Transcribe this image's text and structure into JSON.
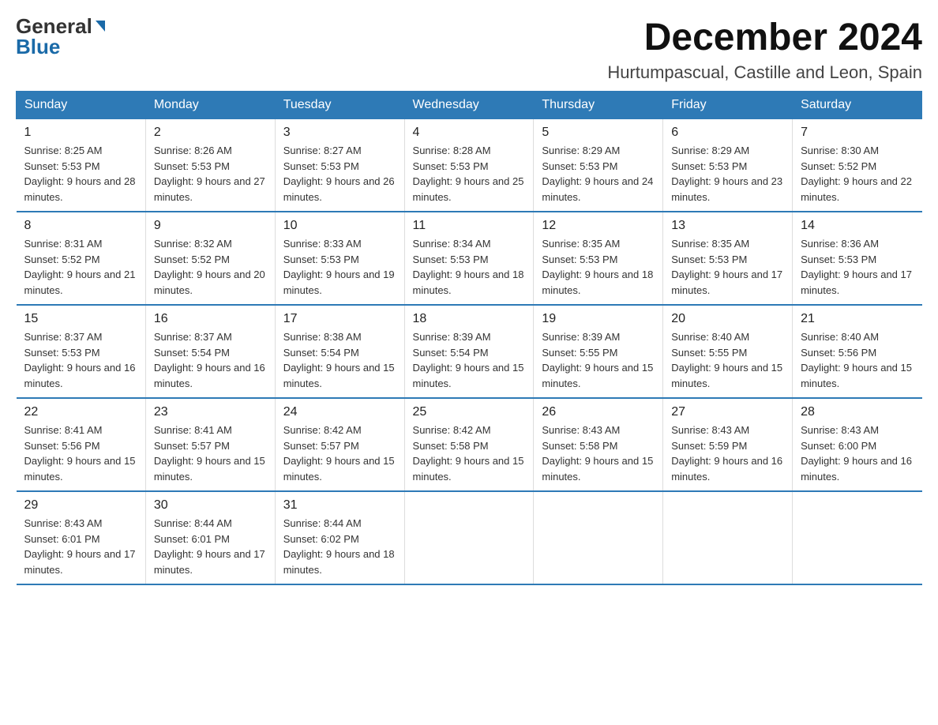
{
  "header": {
    "logo_general": "General",
    "logo_blue": "Blue",
    "month_title": "December 2024",
    "location": "Hurtumpascual, Castille and Leon, Spain"
  },
  "days_of_week": [
    "Sunday",
    "Monday",
    "Tuesday",
    "Wednesday",
    "Thursday",
    "Friday",
    "Saturday"
  ],
  "weeks": [
    [
      {
        "day": "1",
        "sunrise": "8:25 AM",
        "sunset": "5:53 PM",
        "daylight": "9 hours and 28 minutes."
      },
      {
        "day": "2",
        "sunrise": "8:26 AM",
        "sunset": "5:53 PM",
        "daylight": "9 hours and 27 minutes."
      },
      {
        "day": "3",
        "sunrise": "8:27 AM",
        "sunset": "5:53 PM",
        "daylight": "9 hours and 26 minutes."
      },
      {
        "day": "4",
        "sunrise": "8:28 AM",
        "sunset": "5:53 PM",
        "daylight": "9 hours and 25 minutes."
      },
      {
        "day": "5",
        "sunrise": "8:29 AM",
        "sunset": "5:53 PM",
        "daylight": "9 hours and 24 minutes."
      },
      {
        "day": "6",
        "sunrise": "8:29 AM",
        "sunset": "5:53 PM",
        "daylight": "9 hours and 23 minutes."
      },
      {
        "day": "7",
        "sunrise": "8:30 AM",
        "sunset": "5:52 PM",
        "daylight": "9 hours and 22 minutes."
      }
    ],
    [
      {
        "day": "8",
        "sunrise": "8:31 AM",
        "sunset": "5:52 PM",
        "daylight": "9 hours and 21 minutes."
      },
      {
        "day": "9",
        "sunrise": "8:32 AM",
        "sunset": "5:52 PM",
        "daylight": "9 hours and 20 minutes."
      },
      {
        "day": "10",
        "sunrise": "8:33 AM",
        "sunset": "5:53 PM",
        "daylight": "9 hours and 19 minutes."
      },
      {
        "day": "11",
        "sunrise": "8:34 AM",
        "sunset": "5:53 PM",
        "daylight": "9 hours and 18 minutes."
      },
      {
        "day": "12",
        "sunrise": "8:35 AM",
        "sunset": "5:53 PM",
        "daylight": "9 hours and 18 minutes."
      },
      {
        "day": "13",
        "sunrise": "8:35 AM",
        "sunset": "5:53 PM",
        "daylight": "9 hours and 17 minutes."
      },
      {
        "day": "14",
        "sunrise": "8:36 AM",
        "sunset": "5:53 PM",
        "daylight": "9 hours and 17 minutes."
      }
    ],
    [
      {
        "day": "15",
        "sunrise": "8:37 AM",
        "sunset": "5:53 PM",
        "daylight": "9 hours and 16 minutes."
      },
      {
        "day": "16",
        "sunrise": "8:37 AM",
        "sunset": "5:54 PM",
        "daylight": "9 hours and 16 minutes."
      },
      {
        "day": "17",
        "sunrise": "8:38 AM",
        "sunset": "5:54 PM",
        "daylight": "9 hours and 15 minutes."
      },
      {
        "day": "18",
        "sunrise": "8:39 AM",
        "sunset": "5:54 PM",
        "daylight": "9 hours and 15 minutes."
      },
      {
        "day": "19",
        "sunrise": "8:39 AM",
        "sunset": "5:55 PM",
        "daylight": "9 hours and 15 minutes."
      },
      {
        "day": "20",
        "sunrise": "8:40 AM",
        "sunset": "5:55 PM",
        "daylight": "9 hours and 15 minutes."
      },
      {
        "day": "21",
        "sunrise": "8:40 AM",
        "sunset": "5:56 PM",
        "daylight": "9 hours and 15 minutes."
      }
    ],
    [
      {
        "day": "22",
        "sunrise": "8:41 AM",
        "sunset": "5:56 PM",
        "daylight": "9 hours and 15 minutes."
      },
      {
        "day": "23",
        "sunrise": "8:41 AM",
        "sunset": "5:57 PM",
        "daylight": "9 hours and 15 minutes."
      },
      {
        "day": "24",
        "sunrise": "8:42 AM",
        "sunset": "5:57 PM",
        "daylight": "9 hours and 15 minutes."
      },
      {
        "day": "25",
        "sunrise": "8:42 AM",
        "sunset": "5:58 PM",
        "daylight": "9 hours and 15 minutes."
      },
      {
        "day": "26",
        "sunrise": "8:43 AM",
        "sunset": "5:58 PM",
        "daylight": "9 hours and 15 minutes."
      },
      {
        "day": "27",
        "sunrise": "8:43 AM",
        "sunset": "5:59 PM",
        "daylight": "9 hours and 16 minutes."
      },
      {
        "day": "28",
        "sunrise": "8:43 AM",
        "sunset": "6:00 PM",
        "daylight": "9 hours and 16 minutes."
      }
    ],
    [
      {
        "day": "29",
        "sunrise": "8:43 AM",
        "sunset": "6:01 PM",
        "daylight": "9 hours and 17 minutes."
      },
      {
        "day": "30",
        "sunrise": "8:44 AM",
        "sunset": "6:01 PM",
        "daylight": "9 hours and 17 minutes."
      },
      {
        "day": "31",
        "sunrise": "8:44 AM",
        "sunset": "6:02 PM",
        "daylight": "9 hours and 18 minutes."
      },
      null,
      null,
      null,
      null
    ]
  ]
}
